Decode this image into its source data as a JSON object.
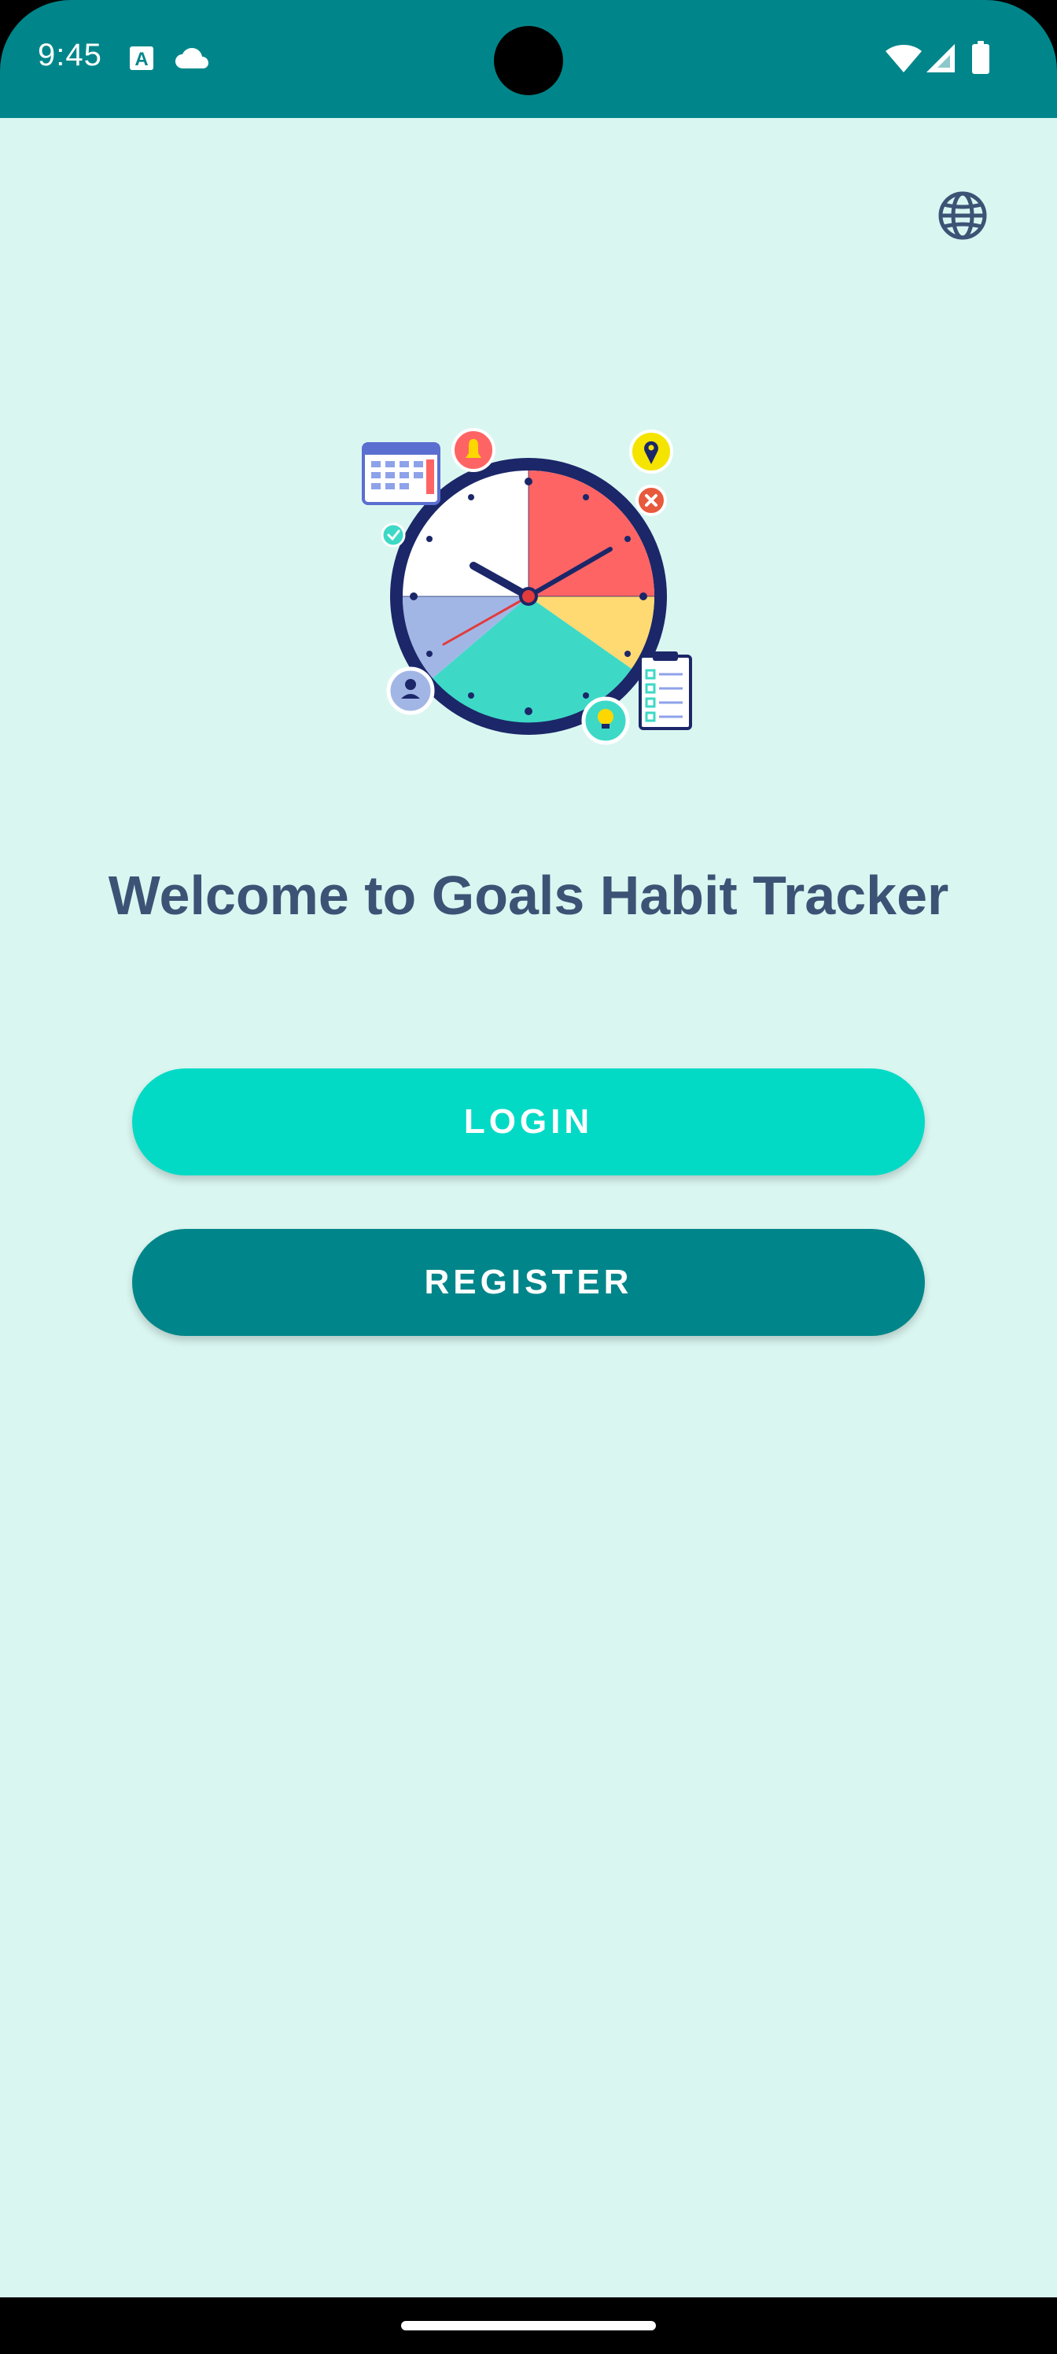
{
  "status_bar": {
    "time": "9:45",
    "background_color": "#00868A",
    "left_icons": [
      "text-notification-icon",
      "cloud-icon"
    ],
    "right_icons": [
      "wifi-icon",
      "cellular-signal-icon",
      "battery-icon"
    ]
  },
  "top_bar": {
    "language_icon": "globe-icon"
  },
  "hero": {
    "illustration": "clock-schedule-illustration"
  },
  "welcome": {
    "title": "Welcome to Goals Habit Tracker",
    "color": "#3D5375"
  },
  "actions": {
    "login_label": "LOGIN",
    "login_color": "#03DAC6",
    "register_label": "REGISTER",
    "register_color": "#00868A"
  },
  "theme": {
    "background": "#DAF6F1"
  }
}
